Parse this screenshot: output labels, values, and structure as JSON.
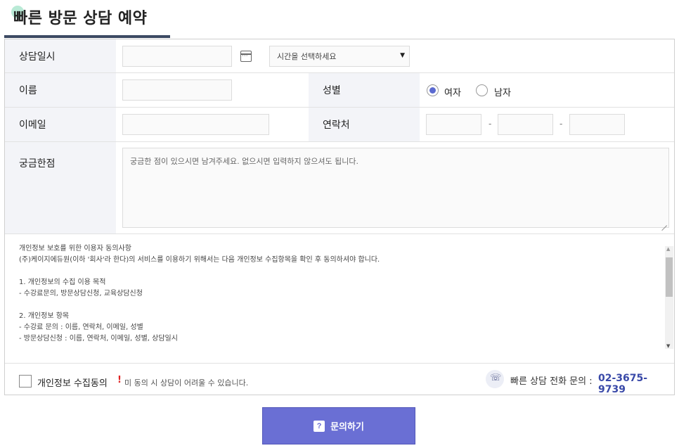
{
  "page": {
    "title": "빠른 방문 상담 예약"
  },
  "form": {
    "datetime_label": "상담일시",
    "time_select": "시간을 선택하세요",
    "name_label": "이름",
    "gender_label": "성별",
    "gender_options": [
      "여자",
      "남자"
    ],
    "gender_selected": "여자",
    "email_label": "이메일",
    "contact_label": "연락처",
    "contact_separator": "-",
    "question_label": "궁금한점",
    "question_placeholder": "궁금한 점이 있으시면 남겨주세요.  없으시면 입력하지 않으셔도 됩니다."
  },
  "terms": {
    "lines": [
      "개인정보 보호를 위한 이용자 동의사항",
      "(주)케이지에듀원(이하 '회사'라 한다)의 서비스를 이용하기 위해서는 다음 개인정보 수집항목을 확인 후 동의하셔야 합니다.",
      "",
      "1. 개인정보의 수집 이용 목적",
      "- 수강료문의, 방문상담신청, 교육상담신청",
      "",
      "2. 개인정보 항목",
      "- 수강료 문의 : 이름, 연락처, 이메일, 성별",
      "- 방문상담신청 : 이름, 연락처, 이메일, 성별, 상담일시"
    ]
  },
  "agree": {
    "label": "개인정보 수집동의",
    "warning_mark": "!",
    "warning_text": "미 동의 시 상담이 어려울 수 있습니다."
  },
  "phone": {
    "label": "빠른 상담 전화 문의 :",
    "number": "02-3675-9739"
  },
  "submit": {
    "icon": "?",
    "label": "문의하기"
  },
  "colors": {
    "accent": "#6a6fd4",
    "phone_number": "#3949a8",
    "warning": "#e02424",
    "label_bg": "#f3f4f8"
  }
}
